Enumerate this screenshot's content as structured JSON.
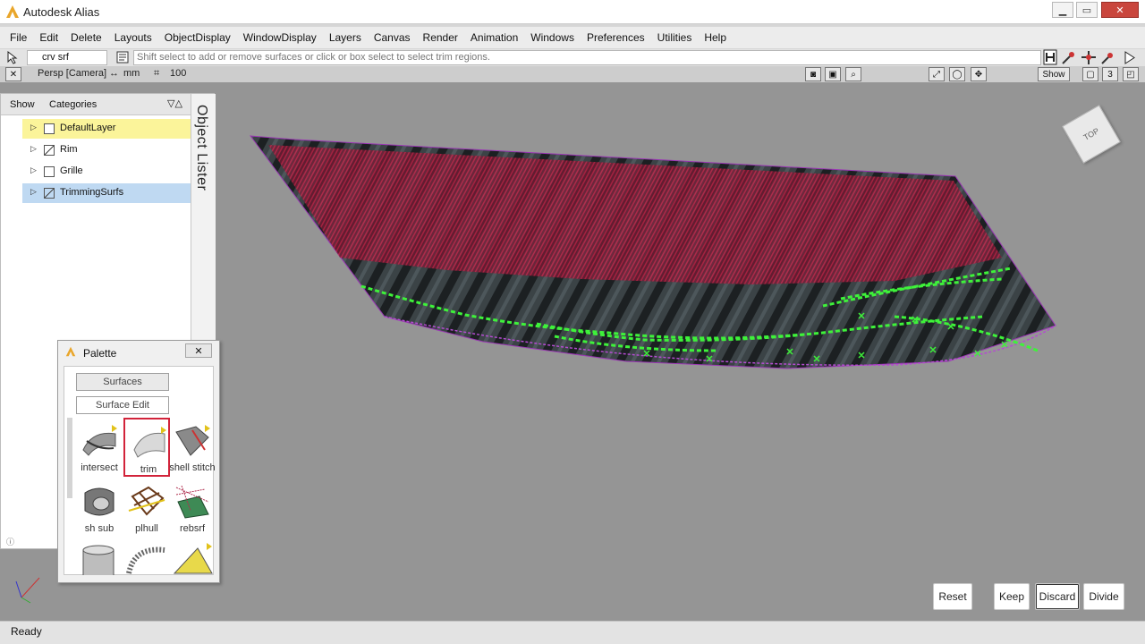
{
  "window": {
    "title": "Autodesk Alias"
  },
  "menu": [
    "File",
    "Edit",
    "Delete",
    "Layouts",
    "ObjectDisplay",
    "WindowDisplay",
    "Layers",
    "Canvas",
    "Render",
    "Animation",
    "Windows",
    "Preferences",
    "Utilities",
    "Help"
  ],
  "command": {
    "name": "crv srf",
    "prompt": "Shift select to add or remove surfaces or click or box select to select trim regions."
  },
  "viewinfo": {
    "view": "Persp [Camera]",
    "units": "mm",
    "grid": "100",
    "show_label": "Show",
    "layout_num": "3"
  },
  "lister": {
    "title": "Object Lister",
    "show_label": "Show",
    "categories_label": "Categories",
    "layers": [
      {
        "name": "DefaultLayer",
        "state": "current"
      },
      {
        "name": "Rim",
        "state": "normal"
      },
      {
        "name": "Grille",
        "state": "normal"
      },
      {
        "name": "TrimmingSurfs",
        "state": "selected"
      }
    ]
  },
  "palette": {
    "title": "Palette",
    "tabs": [
      "Surfaces",
      "Surface Edit"
    ],
    "tools": [
      "intersect",
      "trim",
      "shell stitch",
      "sh sub",
      "plhull",
      "rebsrf"
    ],
    "selected_tool": "trim"
  },
  "viewcube": {
    "label": "TOP"
  },
  "actions": {
    "reset": "Reset",
    "keep": "Keep",
    "discard": "Discard",
    "divide": "Divide"
  },
  "status": {
    "text": "Ready"
  }
}
